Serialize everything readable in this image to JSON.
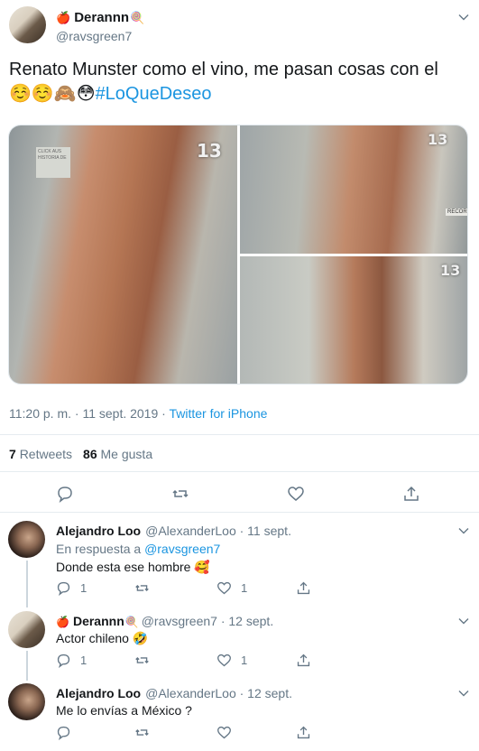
{
  "tweet": {
    "name": "Derannn",
    "handle": "@ravsgreen7",
    "text_plain": "Renato Munster como el vino, me pasan cosas con el",
    "text_emojis": "☺️☺️🙈😳",
    "hashtag": "#LoQueDeseo",
    "media_badge": "13",
    "media_locker_sign": "CLICK AUS HISTORIA DE",
    "media_sign_right": "RECORD",
    "timestamp": "11:20 p. m. · 11 sept. 2019 · ",
    "source": "Twitter for iPhone",
    "retweets_count": "7",
    "retweets_label": "Retweets",
    "likes_count": "86",
    "likes_label": "Me gusta"
  },
  "replies": [
    {
      "name": "Alejandro Loo",
      "handle_time": "@AlexanderLoo · 11 sept.",
      "reply_to_label": "En respuesta a ",
      "reply_to_handle": "@ravsgreen7",
      "text": "Donde esta ese hombre 🥰",
      "reply_count": "1",
      "like_count": "1"
    },
    {
      "name": "Derannn",
      "handle_time": "@ravsgreen7 · 12 sept.",
      "text": "Actor chileno 🤣",
      "reply_count": "1",
      "like_count": "1"
    },
    {
      "name": "Alejandro Loo",
      "handle_time": "@AlexanderLoo · 12 sept.",
      "text": "Me lo envías a México  ?"
    }
  ],
  "icons": {
    "apple": "🍎",
    "lollipop": "🍭"
  },
  "colors": {
    "link": "#1b95e0",
    "secondary": "#657786",
    "border": "#e6ecf0"
  }
}
